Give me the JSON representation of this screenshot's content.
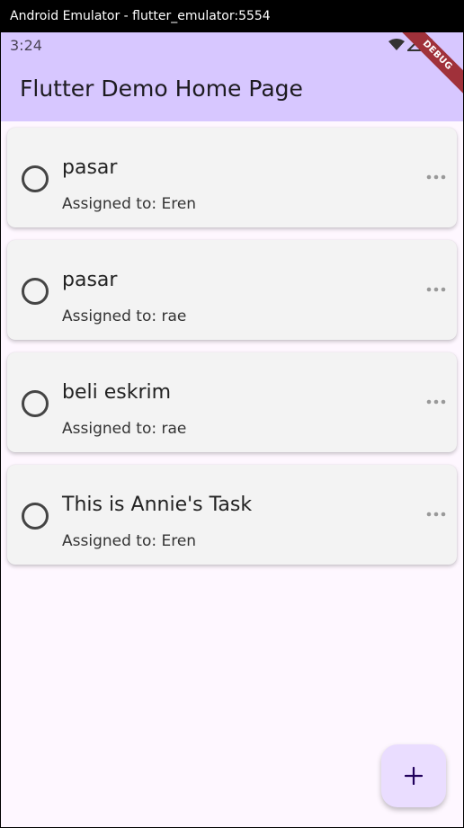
{
  "window": {
    "title": "Android Emulator - flutter_emulator:5554"
  },
  "status_bar": {
    "time": "3:24",
    "icons": [
      "wifi-icon",
      "signal-icon",
      "battery-icon"
    ]
  },
  "app_bar": {
    "title": "Flutter Demo Home Page",
    "debug_banner": "DEBUG"
  },
  "tasks": [
    {
      "title": "pasar",
      "assigned": "Assigned to: Eren",
      "done": false
    },
    {
      "title": "pasar",
      "assigned": "Assigned to: rae",
      "done": false
    },
    {
      "title": "beli eskrim",
      "assigned": "Assigned to: rae",
      "done": false
    },
    {
      "title": "This is Annie's Task",
      "assigned": "Assigned to: Eren",
      "done": false
    }
  ],
  "fab": {
    "icon": "plus-icon"
  },
  "colors": {
    "app_bar_bg": "#d7c7ff",
    "screen_bg": "#fef7ff",
    "card_bg": "#f3f3f3",
    "fab_bg": "#eaddff",
    "debug_ribbon": "#a0313a"
  }
}
